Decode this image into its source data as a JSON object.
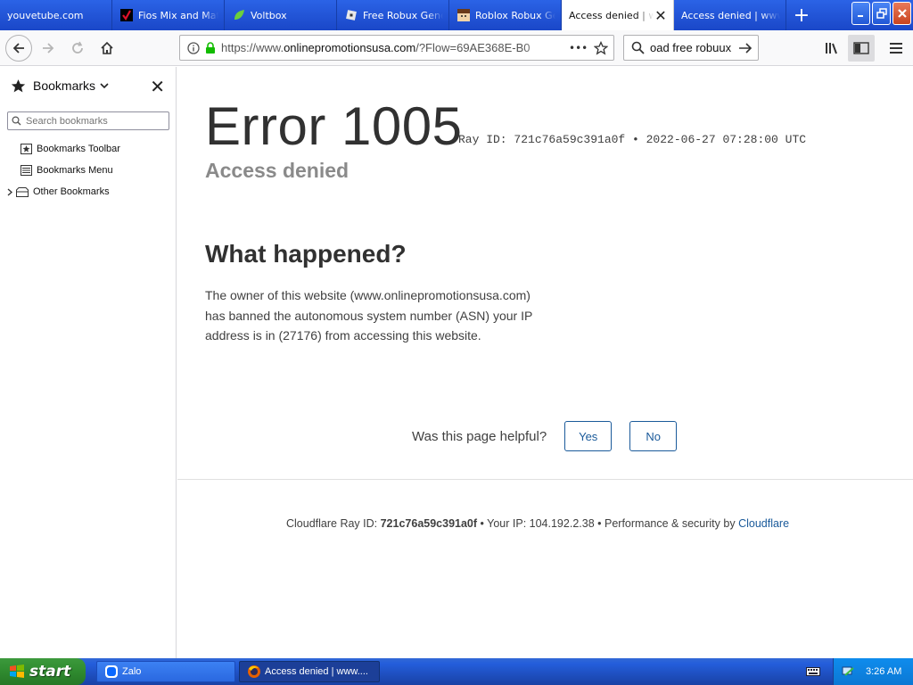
{
  "browser": {
    "tabs": [
      {
        "label": "youvetube.com",
        "favicon": "none"
      },
      {
        "label": "Fios Mix and Match",
        "favicon": "verizon-check-icon"
      },
      {
        "label": "Voltbox",
        "favicon": "leaf-icon"
      },
      {
        "label": "Free Robux Generator",
        "favicon": "roblox-icon"
      },
      {
        "label": "Roblox Robux Generator",
        "favicon": "avatar-icon"
      },
      {
        "label": "Access denied | www.onlinepromotionsusa.com",
        "favicon": "none",
        "active": true
      },
      {
        "label": "Access denied | www.onlinepromotionsusa.com",
        "favicon": "none"
      }
    ],
    "new_tab_label": "+",
    "url": {
      "prefix": "https://www.",
      "host": "onlinepromotionsusa.com",
      "rest": "/?Flow=69AE368E-B0"
    },
    "page_actions_label": "•••",
    "search_value": "oad free robuux",
    "window_controls": [
      "minimize",
      "restore",
      "close"
    ]
  },
  "sidebar": {
    "title": "Bookmarks",
    "search_placeholder": "Search bookmarks",
    "items": [
      {
        "label": "Bookmarks Toolbar",
        "icon": "toolbar-icon"
      },
      {
        "label": "Bookmarks Menu",
        "icon": "menu-icon"
      },
      {
        "label": "Other Bookmarks",
        "icon": "folder-icon"
      }
    ]
  },
  "page": {
    "error_title": "Error 1005",
    "ray_line": "Ray ID: 721c76a59c391a0f • 2022-06-27 07:28:00 UTC",
    "subtitle": "Access denied",
    "what_heading": "What happened?",
    "explanation": "The owner of this website (www.onlinepromotionsusa.com) has banned the autonomous system number (ASN) your IP address is in (27176) from accessing this website.",
    "helpful_question": "Was this page helpful?",
    "yes_label": "Yes",
    "no_label": "No",
    "footer": {
      "ray_label": "Cloudflare Ray ID:",
      "ray_id": "721c76a59c391a0f",
      "ip_label": "• Your IP: 104.192.2.38",
      "perf_label": "• Performance & security by",
      "cloudflare_link": "Cloudflare"
    }
  },
  "taskbar": {
    "start_label": "start",
    "tasks": [
      {
        "label": "Zalo",
        "icon": "zalo-icon"
      },
      {
        "label": "Access denied | www....",
        "icon": "firefox-icon"
      }
    ],
    "clock": "3:26 AM"
  },
  "colors": {
    "link": "#1a5a9a",
    "taskbar_blue": "#245edb",
    "start_green": "#2f8a2f"
  }
}
